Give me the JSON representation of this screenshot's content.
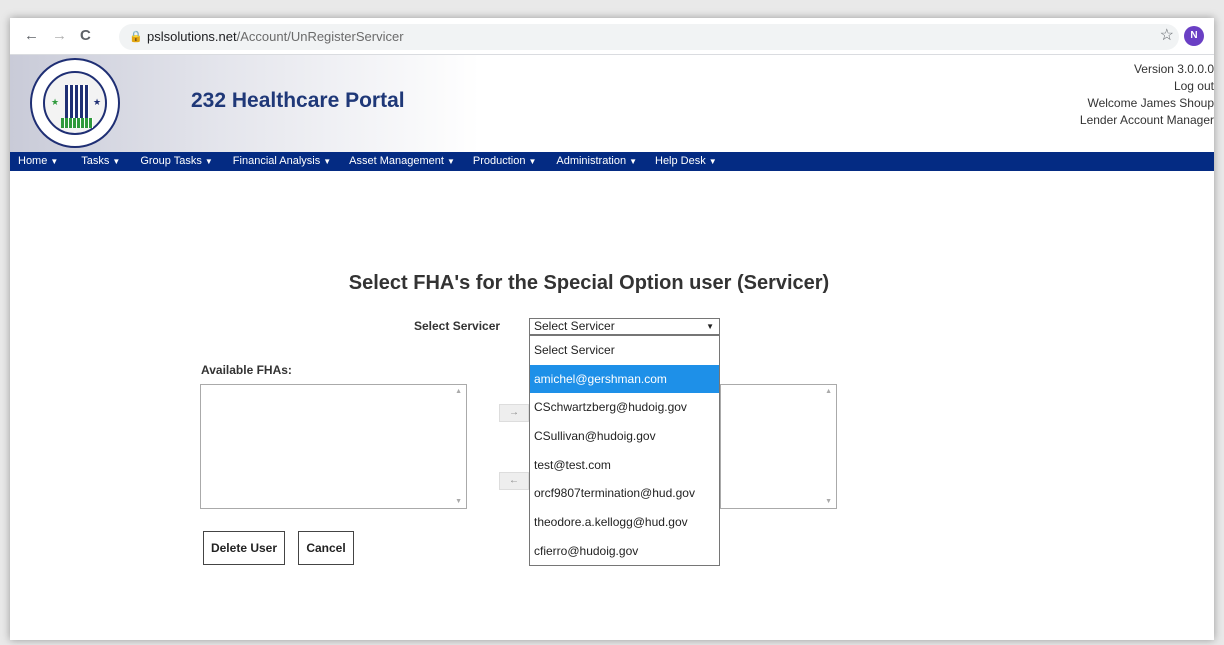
{
  "browser": {
    "back_icon": "←",
    "forward_icon": "→",
    "reload_icon": "C",
    "url_host": "pslsolutions.net",
    "url_path": "/Account/UnRegisterServicer",
    "profile_initial": "N"
  },
  "header": {
    "title": "232 Healthcare Portal",
    "version": "Version 3.0.0.0",
    "logout": "Log out",
    "welcome": "Welcome James Shoup",
    "role": "Lender Account Manager"
  },
  "menu": [
    "Home",
    "Tasks",
    "Group Tasks",
    "Financial Analysis",
    "Asset Management",
    "Production",
    "Administration",
    "Help Desk"
  ],
  "main": {
    "title": "Select FHA's for the Special Option user (Servicer)",
    "servicer_label": "Select Servicer",
    "servicer_selected": "Select Servicer",
    "dropdown_options": [
      "Select Servicer",
      "amichel@gershman.com",
      "CSchwartzberg@hudoig.gov",
      "CSullivan@hudoig.gov",
      "test@test.com",
      "orcf9807termination@hud.gov",
      "theodore.a.kellogg@hud.gov",
      "cfierro@hudoig.gov"
    ],
    "highlighted_option_index": 1,
    "available_label": "Available FHAs:",
    "add_arrow": "→",
    "remove_arrow": "←",
    "delete_button": "Delete User",
    "cancel_button": "Cancel"
  },
  "colors": {
    "menubar": "#042b83",
    "highlight": "#1e90e8",
    "title": "#1f3878"
  }
}
